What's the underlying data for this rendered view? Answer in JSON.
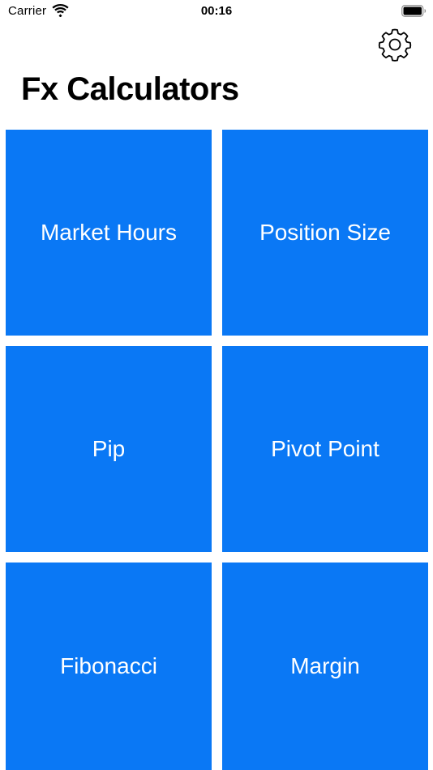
{
  "status_bar": {
    "carrier": "Carrier",
    "time": "00:16",
    "icons": [
      "wifi-icon",
      "battery-icon"
    ]
  },
  "header": {
    "title": "Fx Calculators",
    "settings_icon": "gear-icon"
  },
  "tiles": [
    {
      "label": "Market Hours"
    },
    {
      "label": "Position Size"
    },
    {
      "label": "Pip"
    },
    {
      "label": "Pivot Point"
    },
    {
      "label": "Fibonacci"
    },
    {
      "label": "Margin"
    }
  ],
  "colors": {
    "tile_background": "#0A78F5",
    "tile_text": "#FFFFFF",
    "background": "#FFFFFF",
    "text": "#000000"
  }
}
